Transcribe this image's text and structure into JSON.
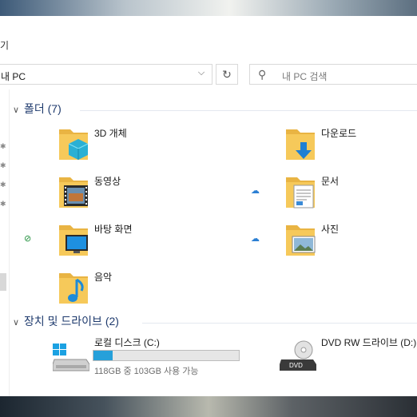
{
  "window": {
    "ribbon_fragment": "기",
    "address": {
      "path": "내 PC",
      "dropdown_icon": "chevron-down-icon",
      "refresh_icon": "refresh-icon"
    },
    "search": {
      "placeholder": "내 PC 검색",
      "icon": "search-icon"
    }
  },
  "groups": [
    {
      "title": "폴더 (7)",
      "items": [
        {
          "label": "3D 개체",
          "icon": "3d-objects-folder-icon"
        },
        {
          "label": "다운로드",
          "icon": "downloads-folder-icon"
        },
        {
          "label": "동영상",
          "icon": "videos-folder-icon"
        },
        {
          "label": "문서",
          "icon": "documents-folder-icon",
          "status": "cloud"
        },
        {
          "label": "바탕 화면",
          "icon": "desktop-folder-icon",
          "status": "synced"
        },
        {
          "label": "사진",
          "icon": "pictures-folder-icon",
          "status": "cloud"
        },
        {
          "label": "음악",
          "icon": "music-folder-icon"
        }
      ]
    },
    {
      "title": "장치 및 드라이브 (2)",
      "drives": [
        {
          "label": "로컬 디스크 (C:)",
          "free_text": "118GB 중 103GB 사용 가능",
          "used_fraction": 0.13,
          "icon": "windows-drive-icon"
        },
        {
          "label": "DVD RW 드라이브 (D:)",
          "icon": "dvd-drive-icon"
        }
      ]
    }
  ],
  "colors": {
    "accent": "#26a0da",
    "group_header": "#1e3a6d",
    "folder": "#f6c95a"
  }
}
